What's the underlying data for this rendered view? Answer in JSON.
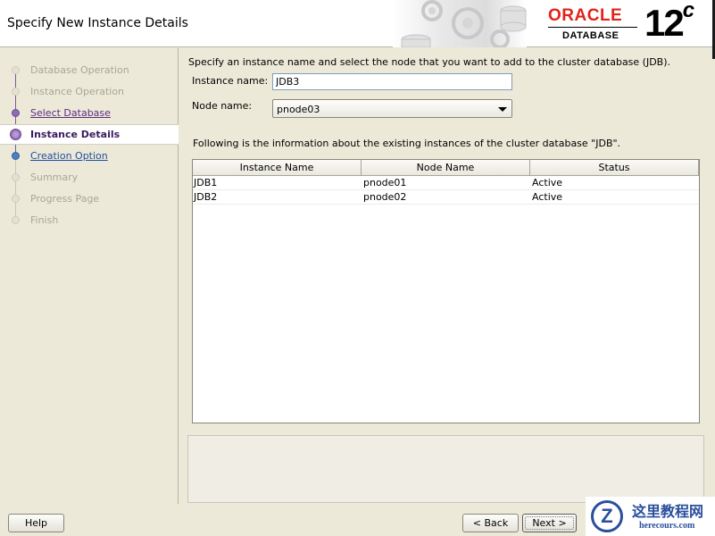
{
  "header": {
    "title": "Specify New Instance Details",
    "logo_oracle": "ORACLE",
    "logo_database": "DATABASE",
    "logo_version": "12",
    "logo_version_suffix": "c"
  },
  "nav": {
    "items": [
      {
        "label": "Database Operation",
        "state": "disabled"
      },
      {
        "label": "Instance Operation",
        "state": "disabled"
      },
      {
        "label": "Select Database",
        "state": "visited"
      },
      {
        "label": "Instance Details",
        "state": "current"
      },
      {
        "label": "Creation Option",
        "state": "next"
      },
      {
        "label": "Summary",
        "state": "disabled"
      },
      {
        "label": "Progress Page",
        "state": "disabled"
      },
      {
        "label": "Finish",
        "state": "disabled"
      }
    ]
  },
  "main": {
    "intro": "Specify an instance name and select the node that you want to add to the cluster database (JDB).",
    "instance_name_label": "Instance name:",
    "instance_name_value": "JDB3",
    "node_name_label": "Node name:",
    "node_name_value": "pnode03",
    "info": "Following is the information about the existing instances of the cluster database \"JDB\".",
    "table": {
      "columns": [
        "Instance Name",
        "Node Name",
        "Status"
      ],
      "rows": [
        [
          "JDB1",
          "pnode01",
          "Active"
        ],
        [
          "JDB2",
          "pnode02",
          "Active"
        ]
      ]
    }
  },
  "footer": {
    "help": "Help",
    "back": "< Back",
    "next": "Next >"
  },
  "watermark": {
    "title": "这里教程网",
    "url": "herecours.com"
  },
  "colors": {
    "oracle_red": "#e2231a",
    "visited": "#5a2d82",
    "link": "#1f4fa0",
    "panel": "#ece9d8"
  }
}
